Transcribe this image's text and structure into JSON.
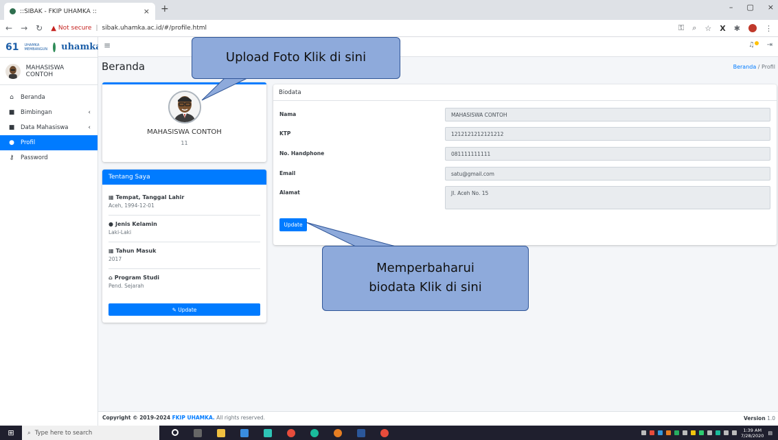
{
  "browser": {
    "tab_title": "::SIBAK - FKIP UHAMKA ::",
    "new_tab": "+",
    "tab_close": "×",
    "not_secure": "Not secure",
    "url": "sibak.uhamka.ac.id/#/profile.html",
    "win_minimize": "–",
    "win_restore": "▢",
    "win_close": "×"
  },
  "brand": {
    "logo_number": "61",
    "logo_small": "UHAMKA MEMBANGUN",
    "logo_word": "uhamka"
  },
  "sidebar": {
    "user_name": "MAHASISWA CONTOH",
    "items": [
      {
        "label": "Beranda",
        "icon": "home-icon",
        "glyph": "⌂",
        "chevron": ""
      },
      {
        "label": "Bimbingan",
        "icon": "book-icon",
        "glyph": "■",
        "chevron": "‹"
      },
      {
        "label": "Data Mahasiswa",
        "icon": "id-card-icon",
        "glyph": "■",
        "chevron": "‹"
      },
      {
        "label": "Profil",
        "icon": "user-icon",
        "glyph": "●",
        "chevron": ""
      },
      {
        "label": "Password",
        "icon": "key-icon",
        "glyph": "⚷",
        "chevron": ""
      }
    ]
  },
  "header": {
    "page_title": "Beranda",
    "breadcrumb_link": "Beranda",
    "breadcrumb_sep": " / ",
    "breadcrumb_current": "Profil"
  },
  "profile": {
    "name": "MAHASISWA CONTOH",
    "sub": "11"
  },
  "about": {
    "title": "Tentang Saya",
    "items": [
      {
        "label": "Tempat, Tanggal Lahir",
        "value": "Aceh, 1994-12-01"
      },
      {
        "label": "Jenis Kelamin",
        "value": "Laki-Laki"
      },
      {
        "label": "Tahun Masuk",
        "value": "2017"
      },
      {
        "label": "Program Studi",
        "value": "Pend. Sejarah"
      }
    ],
    "update_label": "Update"
  },
  "biodata": {
    "title": "Biodata",
    "fields": [
      {
        "label": "Nama",
        "value": "MAHASISWA CONTOH"
      },
      {
        "label": "KTP",
        "value": "1212121212121212"
      },
      {
        "label": "No. Handphone",
        "value": "081111111111"
      },
      {
        "label": "Email",
        "value": "satu@gmail.com"
      },
      {
        "label": "Alamat",
        "value": "Jl. Aceh No. 15"
      }
    ],
    "update_label": "Update"
  },
  "callouts": {
    "upload": "Upload Foto Klik di sini",
    "update_line1": "Memperbaharui",
    "update_line2": "biodata  Klik di sini"
  },
  "footer": {
    "copyright": "Copyright © 2019-2024 ",
    "org": "FKIP UHAMKA.",
    "rights": " All rights reserved.",
    "version_label": "Version",
    "version_value": "1.0"
  },
  "taskbar": {
    "search_placeholder": "Type here to search",
    "time": "1:39 AM",
    "date": "7/28/2020"
  },
  "colors": {
    "primary": "#007bff",
    "callout_fill": "#8eaadb",
    "callout_border": "#2f5597"
  }
}
